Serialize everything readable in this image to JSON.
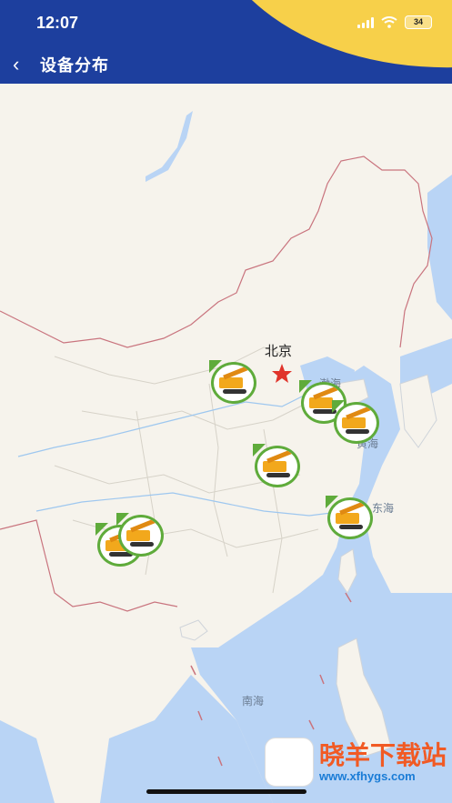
{
  "status_bar": {
    "time": "12:07",
    "battery": "34"
  },
  "header": {
    "back_icon": "‹",
    "title": "设备分布"
  },
  "map_labels": {
    "beijing": "北京",
    "bohai": "渤海",
    "huanghai": "黄海",
    "donghai": "东海",
    "nanhai": "南海"
  },
  "markers": [
    {
      "name": "marker-shanxi"
    },
    {
      "name": "marker-hebei"
    },
    {
      "name": "marker-shandong"
    },
    {
      "name": "marker-henan"
    },
    {
      "name": "marker-zhejiang"
    },
    {
      "name": "marker-guizhou-1"
    },
    {
      "name": "marker-guizhou-2"
    }
  ],
  "watermark": {
    "title": "晓羊下载站",
    "url": "www.xfhygs.com"
  },
  "colors": {
    "header": "#1d3f9e",
    "accent": "#f7d04a",
    "land": "#f6f3ec",
    "sea": "#b9d4f5",
    "marker_ring": "#5fab3b"
  }
}
